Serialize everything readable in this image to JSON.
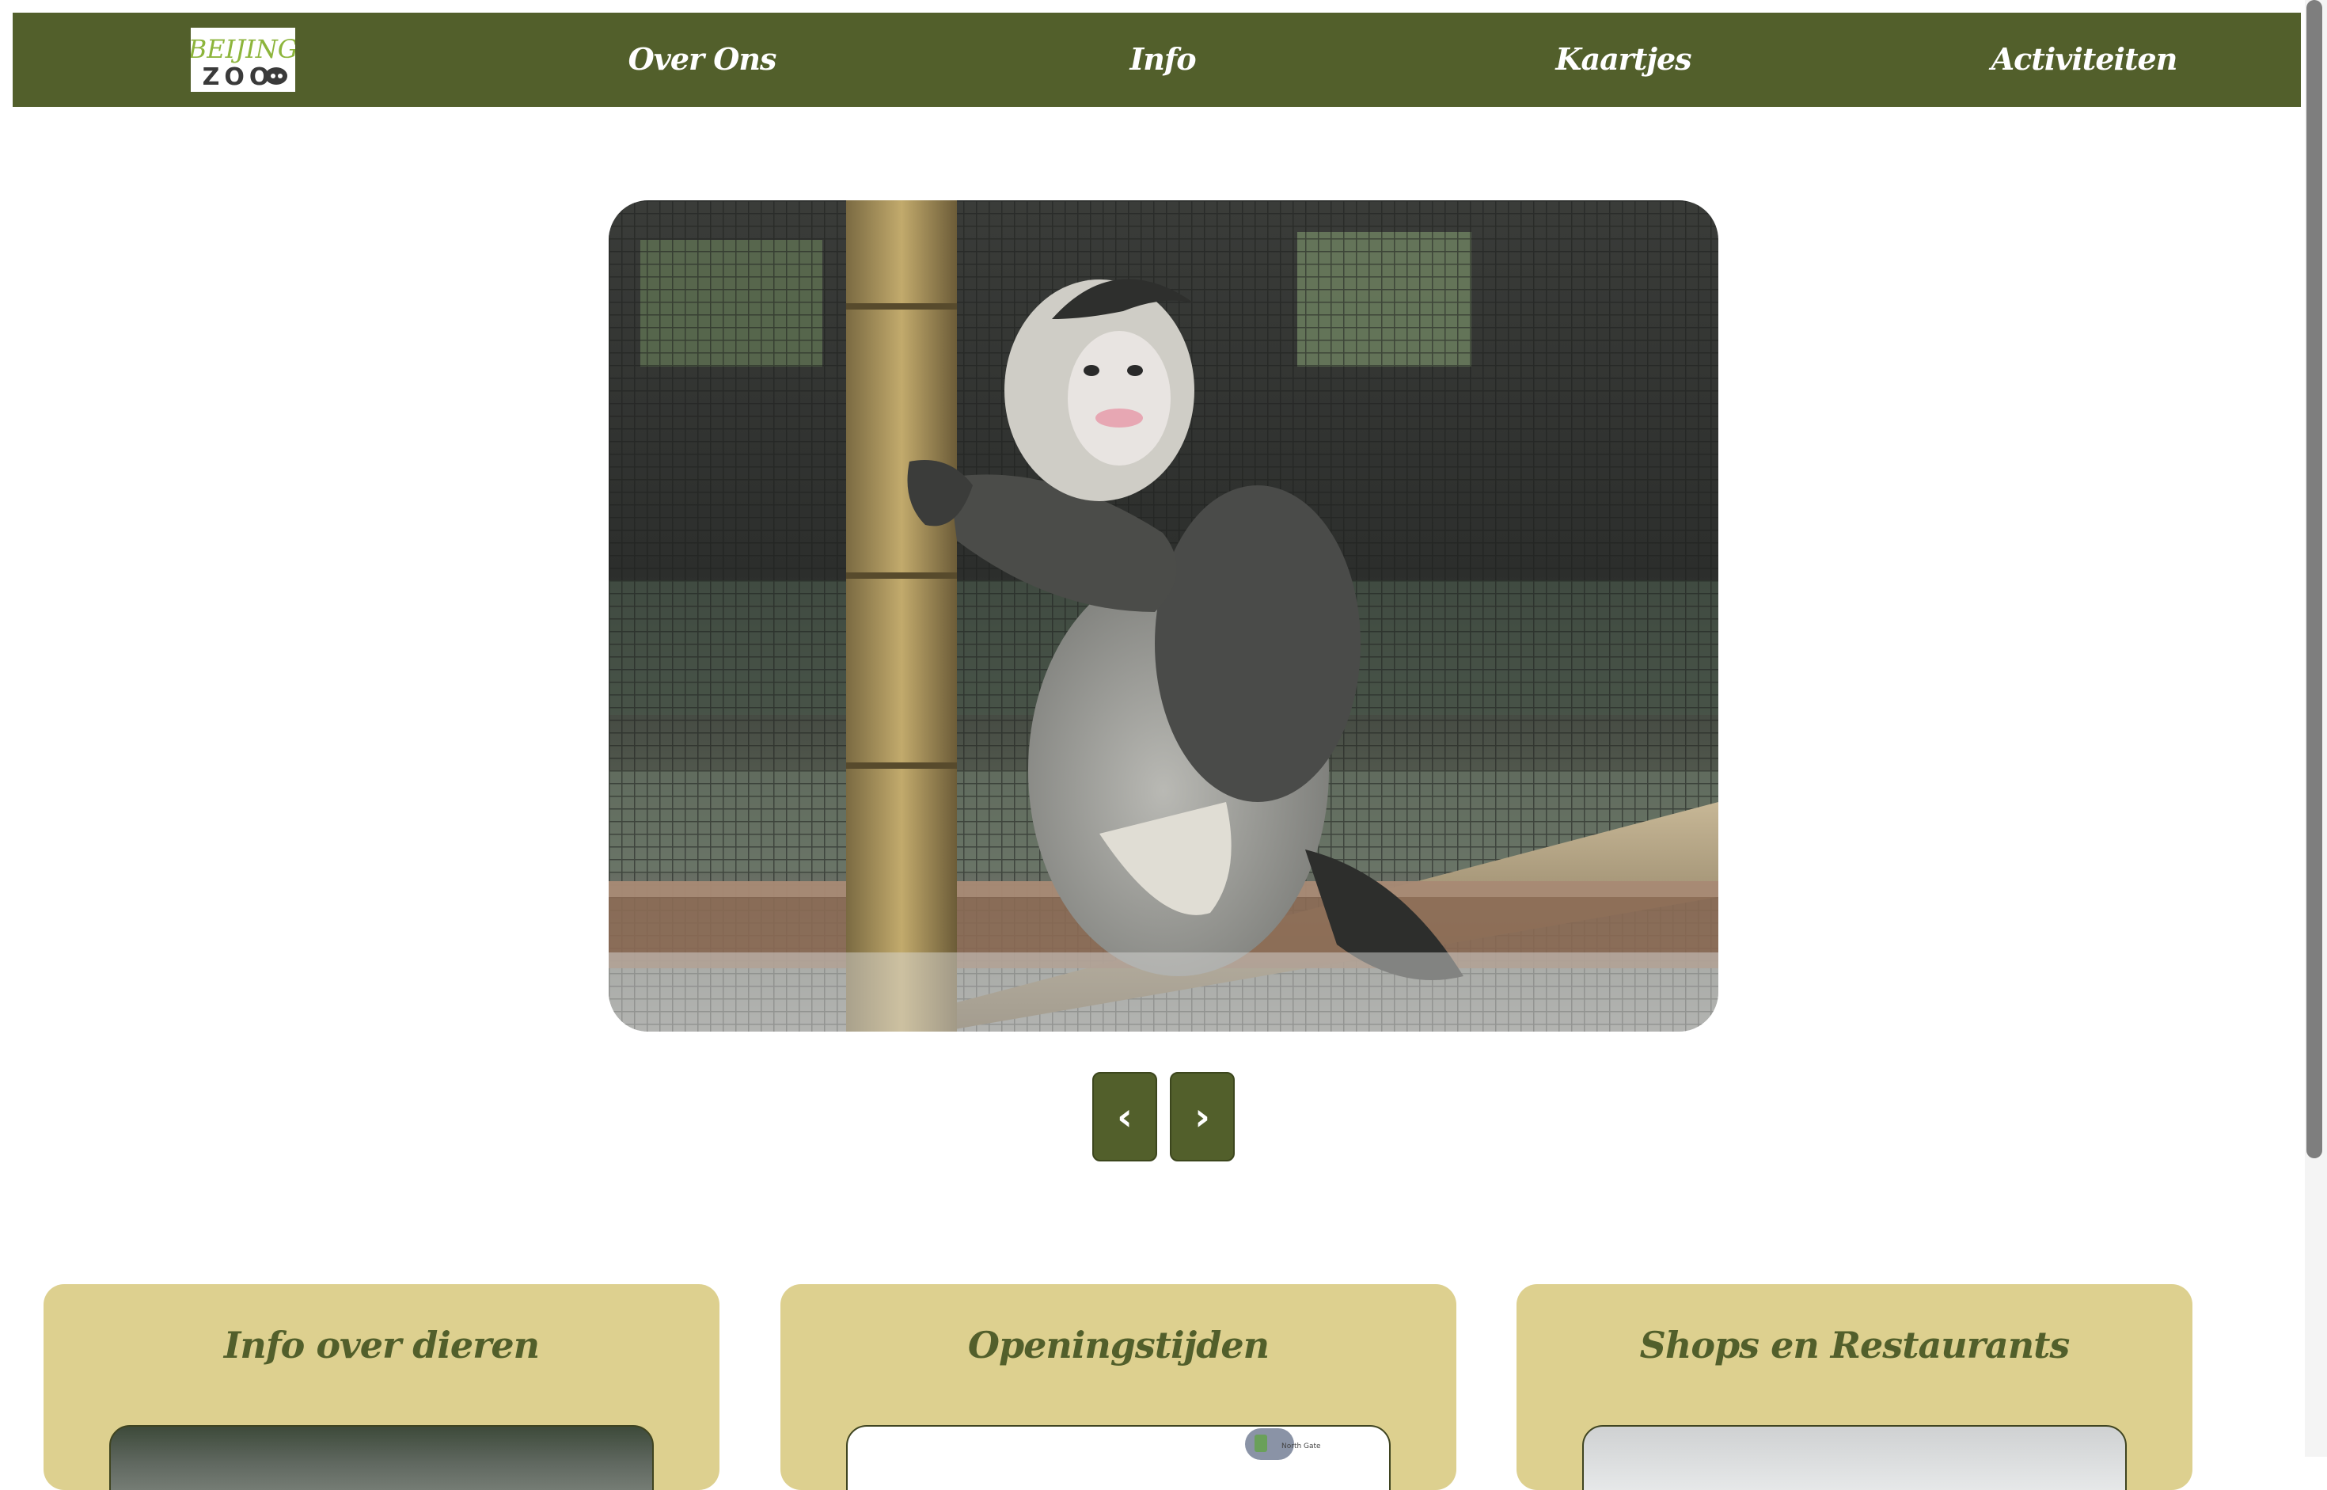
{
  "brand": {
    "logo_line1": "BEIJING",
    "logo_line2": "ZOO",
    "logo_colors": {
      "top": "#8db53c",
      "bottom": "#3a3a3a"
    }
  },
  "nav": {
    "background": "#525f2b",
    "links": [
      "Over Ons",
      "Info",
      "Kaartjes",
      "Activiteiten"
    ]
  },
  "slider": {
    "prev_label": "‹",
    "next_label": "›",
    "button_color": "#525f2b",
    "current_image": "snub-nosed-monkey-photo"
  },
  "cards": [
    {
      "title": "Info over dieren",
      "image": "animal-photo"
    },
    {
      "title": "Openingstijden",
      "image": "map-preview",
      "map_label": "North Gate"
    },
    {
      "title": "Shops en Restaurants",
      "image": "shop-photo"
    }
  ],
  "colors": {
    "card_background": "#ddd08f",
    "card_title": "#525f2b"
  }
}
